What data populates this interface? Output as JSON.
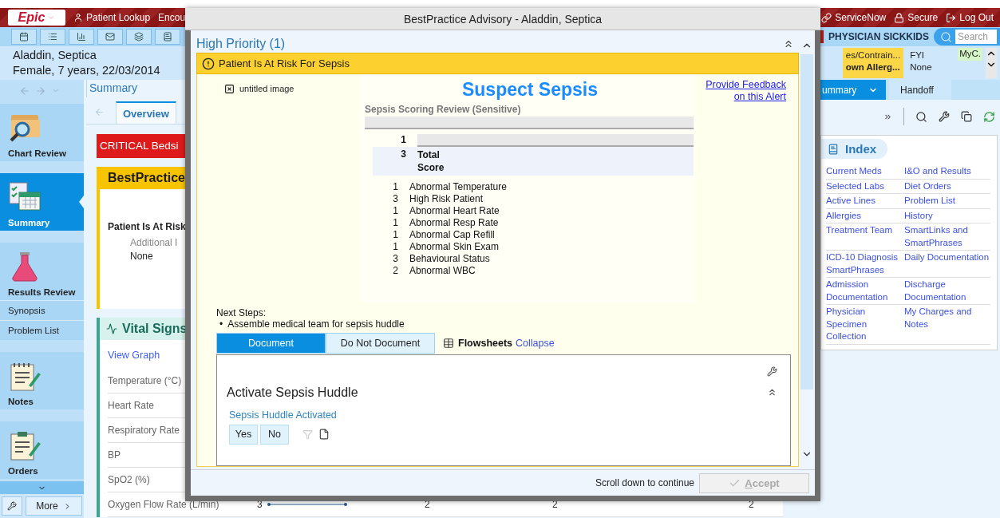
{
  "top_bar": {
    "logo": "Epic",
    "menu": [
      "Patient Lookup",
      "Encou"
    ],
    "actions": [
      "ServiceNow",
      "Secure",
      "Log Out"
    ]
  },
  "tool_row": {
    "department": "PHYSICIAN SICKKIDS",
    "search": {
      "placeholder": "Search"
    }
  },
  "patient": {
    "name": "Aladdin, Septica",
    "details": "Female, 7 years, 22/03/2014"
  },
  "header_badges": [
    {
      "kind": "allergy",
      "label": "es/Contrain...",
      "value": "own Allerg..."
    },
    {
      "kind": "fyi",
      "label": "FYI",
      "value": "None"
    },
    {
      "kind": "mychart",
      "label": "MyC."
    }
  ],
  "sidebar": {
    "items": [
      {
        "label": "Chart Review",
        "kind": "large",
        "selected": false
      },
      {
        "label": "Summary",
        "kind": "large",
        "selected": true
      },
      {
        "label": "Results Review",
        "kind": "large",
        "selected": false
      },
      {
        "label": "Synopsis",
        "kind": "small",
        "selected": false
      },
      {
        "label": "Problem List",
        "kind": "small",
        "selected": false
      },
      {
        "label": "Notes",
        "kind": "large",
        "selected": false
      },
      {
        "label": "Orders",
        "kind": "large",
        "selected": false
      }
    ],
    "more": "More"
  },
  "summary": {
    "title": "Summary",
    "tabs": [
      {
        "label": "Overview",
        "selected": true
      }
    ],
    "critical": "CRITICAL Bedsi",
    "bpa": {
      "title": "BestPractice",
      "alert": "Patient Is At Risk",
      "info_label": "Additional I",
      "info_value": "None"
    },
    "vitals": {
      "title": "Vital Signs",
      "link": "View Graph",
      "rows": [
        {
          "label": "Temperature (°C)"
        },
        {
          "label": "Heart Rate"
        },
        {
          "label": "Respiratory Rate"
        },
        {
          "label": "BP"
        },
        {
          "label": "SpO2 (%)"
        },
        {
          "label": "Oxygen Flow Rate (L/min)",
          "values": [
            "3",
            "2",
            "2",
            "2"
          ]
        }
      ]
    }
  },
  "right_panel": {
    "tabs": [
      {
        "label": "ummary",
        "selected": true
      },
      {
        "label": "Handoff",
        "selected": false
      }
    ],
    "index": {
      "title": "Index",
      "rows": [
        [
          "Current Meds",
          "I&O and Results"
        ],
        [
          "Selected Labs",
          "Diet Orders"
        ],
        [
          "Active Lines",
          "Problem List"
        ],
        [
          "Allergies",
          "History"
        ],
        [
          "Treatment Team",
          "SmartLinks and SmartPhrases"
        ],
        [
          "ICD-10 Diagnosis SmartPhrases",
          "Daily Documentation"
        ],
        [
          "Admission Documentation",
          "Discharge Documentation"
        ],
        [
          "Physician Specimen Collection",
          "My Charges and Notes"
        ]
      ]
    }
  },
  "advisory": {
    "title": "BestPractice Advisory - Aladdin, Septica",
    "section": "High Priority (1)",
    "alert": {
      "title": "Patient Is At Risk For Sepsis",
      "image_alt": "untitled image",
      "heading": "Suspect Sepsis",
      "subheading": "Sepsis Scoring Review (Sensitive)",
      "feedback_link": "Provide Feedback on this Alert",
      "table": {
        "header_score": "1",
        "total_score": "3",
        "total_label": "Total Score",
        "rows": [
          {
            "score": "1",
            "item": "Abnormal Temperature"
          },
          {
            "score": "3",
            "item": "High Risk Patient"
          },
          {
            "score": "1",
            "item": "Abnormal Heart Rate"
          },
          {
            "score": "1",
            "item": "Abnormal Resp Rate"
          },
          {
            "score": "1",
            "item": "Abnormal Cap Refill"
          },
          {
            "score": "1",
            "item": "Abnormal Skin Exam"
          },
          {
            "score": "3",
            "item": "Behavioural Status"
          },
          {
            "score": "2",
            "item": "Abnormal WBC"
          }
        ]
      },
      "next_steps_label": "Next Steps:",
      "next_steps": [
        {
          "bullet": "•",
          "text": "Assemble medical team for sepsis huddle"
        }
      ],
      "actions": [
        {
          "label": "Document",
          "selected": true
        },
        {
          "label": "Do Not Document",
          "selected": false
        }
      ],
      "flowsheets": "Flowsheets",
      "collapse": "Collapse",
      "form": {
        "title": "Activate Sepsis Huddle",
        "question": "Sepsis Huddle Activated",
        "options": [
          {
            "label": "Yes",
            "selected": false
          },
          {
            "label": "No",
            "selected": false
          }
        ]
      }
    },
    "footer": {
      "hint": "Scroll down to continue",
      "accept": {
        "label": "Accept",
        "disabled": true
      }
    }
  }
}
